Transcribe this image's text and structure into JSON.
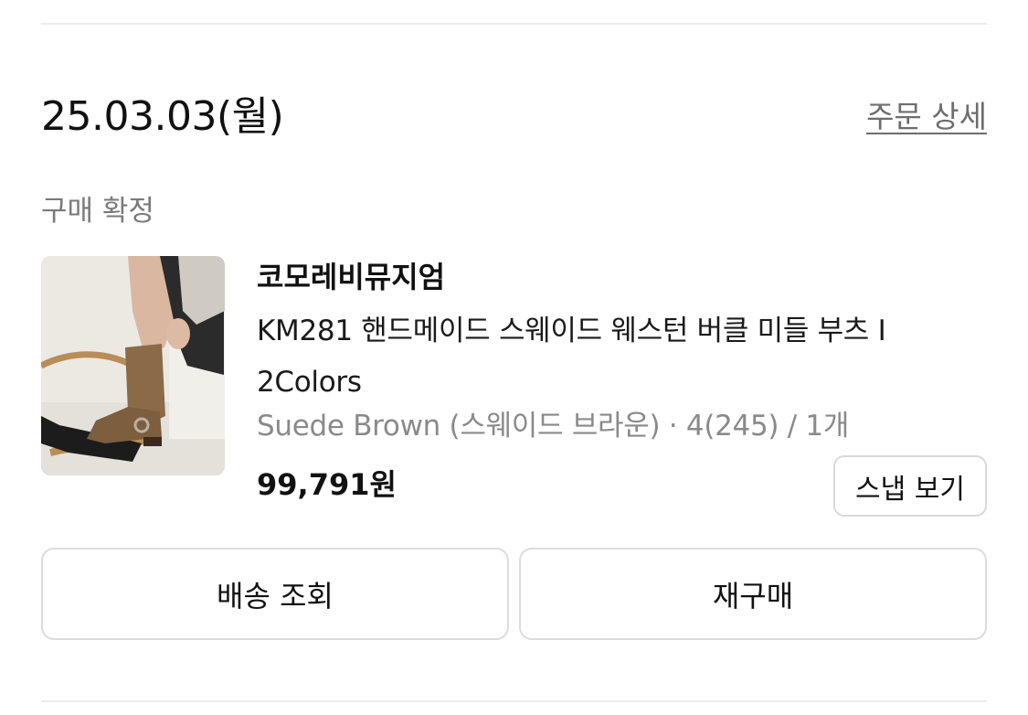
{
  "order": {
    "date": "25.03.03(월)",
    "detail_link": "주문 상세",
    "status": "구매 확정"
  },
  "product": {
    "brand": "코모레비뮤지엄",
    "name": "KM281 핸드메이드 스웨이드 웨스턴 버클 미들 부츠 I 2Colors",
    "option": "Suede Brown (스웨이드 브라운) · 4(245) / 1개",
    "price": "99,791원",
    "snap_button_label": "스냅 보기",
    "image_alt": "product-photo-suede-western-boot"
  },
  "actions": {
    "track_delivery_label": "배송 조회",
    "repurchase_label": "재구매"
  },
  "colors": {
    "text_primary": "#111111",
    "text_secondary": "#8a8a8a",
    "link": "#6d6d6d",
    "border": "#dcdcdc"
  }
}
